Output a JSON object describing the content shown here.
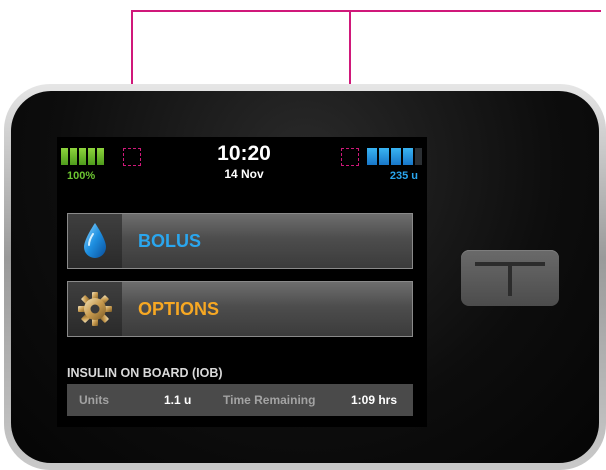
{
  "status_bar": {
    "battery_percent": "100%",
    "battery_level": 1.0,
    "time": "10:20",
    "date": "14 Nov",
    "insulin_units": "235 u",
    "reservoir_level": 0.8
  },
  "menu": {
    "bolus_label": "BOLUS",
    "options_label": "OPTIONS"
  },
  "iob": {
    "title": "INSULIN ON BOARD (IOB)",
    "units_label": "Units",
    "units_value": "1.1 u",
    "time_label": "Time Remaining",
    "time_value": "1:09 hrs"
  },
  "icons": {
    "bolus": "water-drop-icon",
    "options": "gear-icon"
  },
  "colors": {
    "battery": "#6cc631",
    "reservoir": "#2aa6ee",
    "bolus": "#2aa6ee",
    "options": "#f7a823",
    "callout": "#d0187a"
  }
}
